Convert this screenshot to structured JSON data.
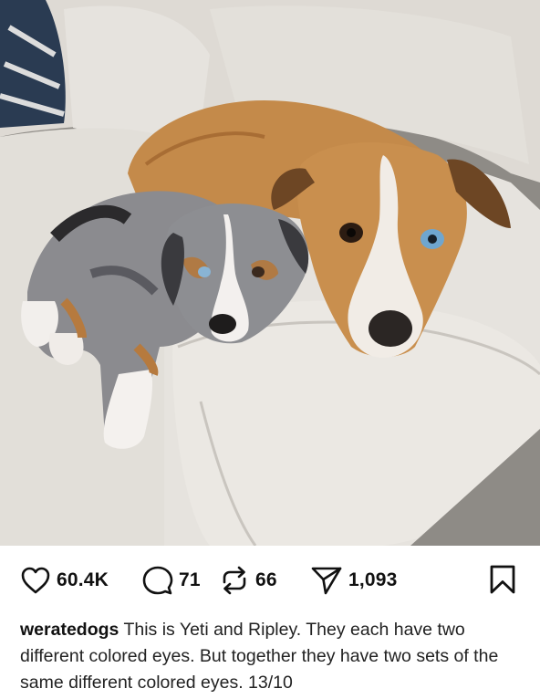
{
  "post": {
    "image": {
      "alt_subject": "two dogs lying on a white leather couch",
      "colors": {
        "couch": "#e4e1dc",
        "shadow": "#c9c5bf",
        "floor": "#8e8b86"
      }
    },
    "actions": {
      "likes": "60.4K",
      "comments": "71",
      "reposts": "66",
      "shares": "1,093"
    },
    "icons": {
      "like": "heart-icon",
      "comment": "comment-bubble-icon",
      "repost": "repost-icon",
      "share": "send-icon",
      "save": "bookmark-icon"
    },
    "caption": {
      "username": "weratedogs",
      "text": "This is Yeti and Ripley. They each have two different colored eyes. But together they have two sets of the same different colored eyes. 13/10"
    }
  }
}
